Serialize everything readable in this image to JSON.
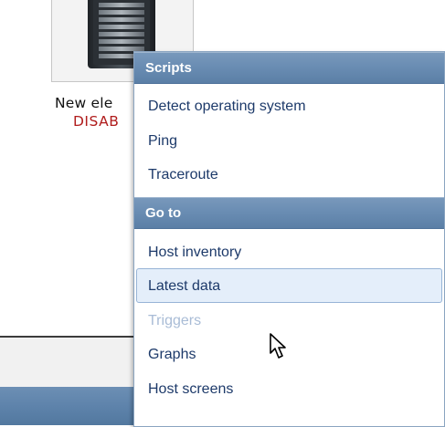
{
  "map": {
    "element": {
      "label": "New ele",
      "status": "DISAB",
      "icon": "server-icon"
    },
    "colors": {
      "status_disabled": "#b01c1c",
      "header_blue": "#6a8db3"
    }
  },
  "context_menu": {
    "sections": [
      {
        "title": "Scripts",
        "items": [
          {
            "label": "Detect operating system",
            "state": "normal"
          },
          {
            "label": "Ping",
            "state": "normal"
          },
          {
            "label": "Traceroute",
            "state": "normal"
          }
        ]
      },
      {
        "title": "Go to",
        "items": [
          {
            "label": "Host inventory",
            "state": "normal"
          },
          {
            "label": "Latest data",
            "state": "highlighted"
          },
          {
            "label": "Triggers",
            "state": "disabled"
          },
          {
            "label": "Graphs",
            "state": "normal"
          },
          {
            "label": "Host screens",
            "state": "normal"
          }
        ]
      }
    ]
  },
  "cursor": {
    "icon": "mouse-pointer-icon"
  }
}
